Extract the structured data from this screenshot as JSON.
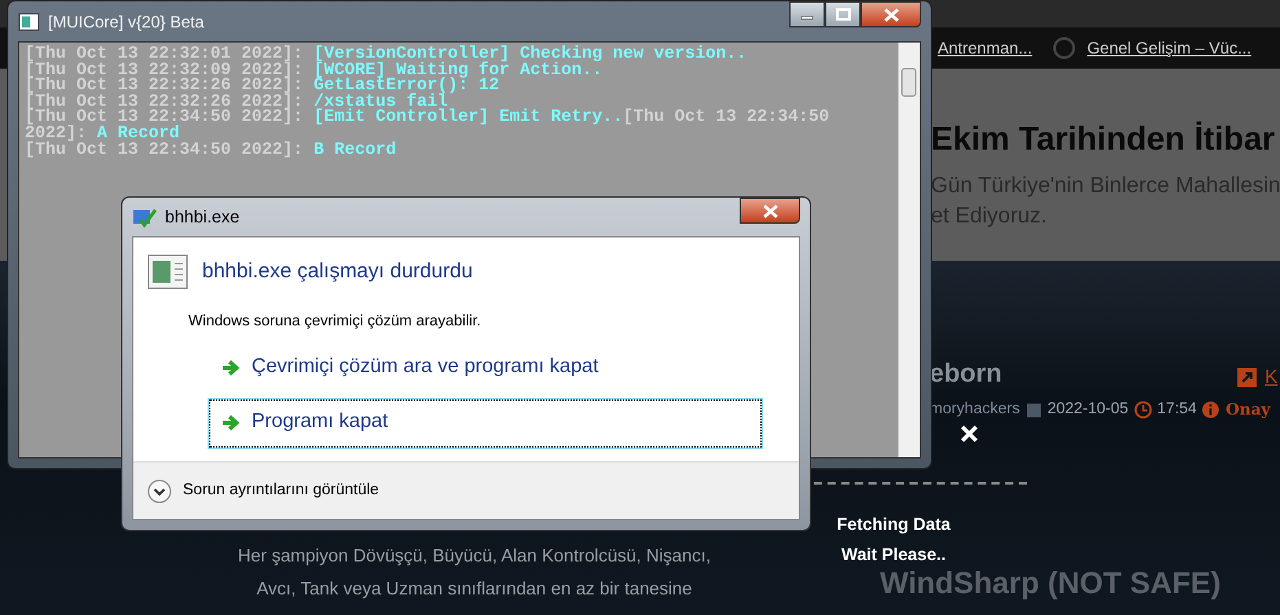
{
  "browser_page": {
    "bookmarks": [
      {
        "label": "Antrenman..."
      },
      {
        "label": "Genel Gelişim – Vüc..."
      }
    ],
    "hero": {
      "heading": "Ekim Tarihinden İtibar",
      "subtitle_lines": [
        "Gün Türkiye'nin Binlerce Mahallesin",
        "et Ediyoruz."
      ]
    },
    "posts": [
      {
        "title": "eborn",
        "author": "moryhackers",
        "date": "2022-10-05",
        "time": "17:54",
        "status": "Onay",
        "link": "K"
      },
      {
        "title": "WindSharp (NOT SAFE)"
      }
    ],
    "description_lines": [
      "Her şampiyon Dövüşçü, Büyücü, Alan Kontrolcüsü, Nişancı,",
      "Avcı, Tank veya Uzman sınıflarından en az bir tanesine"
    ]
  },
  "loading_overlay": {
    "lines": [
      "Fetching Data",
      "Wait Please.."
    ]
  },
  "console_window": {
    "title": "[MUICore] v{20} Beta",
    "lines": [
      [
        {
          "kind": "timestamp",
          "text": "[Thu Oct 13 22:32:01 2022]:"
        },
        {
          "kind": "message",
          "text": "[VersionController] Checking new version.."
        }
      ],
      [
        {
          "kind": "timestamp",
          "text": "[Thu Oct 13 22:32:09 2022]:"
        },
        {
          "kind": "message",
          "text": "[WCORE] Waiting for Action.."
        }
      ],
      [
        {
          "kind": "timestamp",
          "text": "[Thu Oct 13 22:32:26 2022]:"
        },
        {
          "kind": "message",
          "text": "GetLastError(): 12"
        }
      ],
      [
        {
          "kind": "timestamp",
          "text": "[Thu Oct 13 22:32:26 2022]:"
        },
        {
          "kind": "message",
          "text": "/xstatus fail"
        }
      ],
      [
        {
          "kind": "timestamp",
          "text": "[Thu Oct 13 22:34:50 2022]:"
        },
        {
          "kind": "message",
          "text": "[Emit Controller]  Emit Retry.."
        },
        {
          "kind": "timestamp",
          "text": "[Thu Oct 13 22:34:50 2022]:"
        },
        {
          "kind": "message",
          "text": "A Record"
        }
      ],
      [
        {
          "kind": "timestamp",
          "text": "[Thu Oct 13 22:34:50 2022]:"
        },
        {
          "kind": "message",
          "text": "B Record"
        }
      ]
    ]
  },
  "error_dialog": {
    "title": "bhhbi.exe",
    "heading": "bhhbi.exe çalışmayı durdurdu",
    "description": "Windows soruna çevrimiçi çözüm arayabilir.",
    "options": [
      {
        "label": "Çevrimiçi çözüm ara ve programı kapat",
        "selected": false
      },
      {
        "label": "Programı kapat",
        "selected": true
      }
    ],
    "details_toggle": "Sorun ayrıntılarını görüntüle"
  }
}
